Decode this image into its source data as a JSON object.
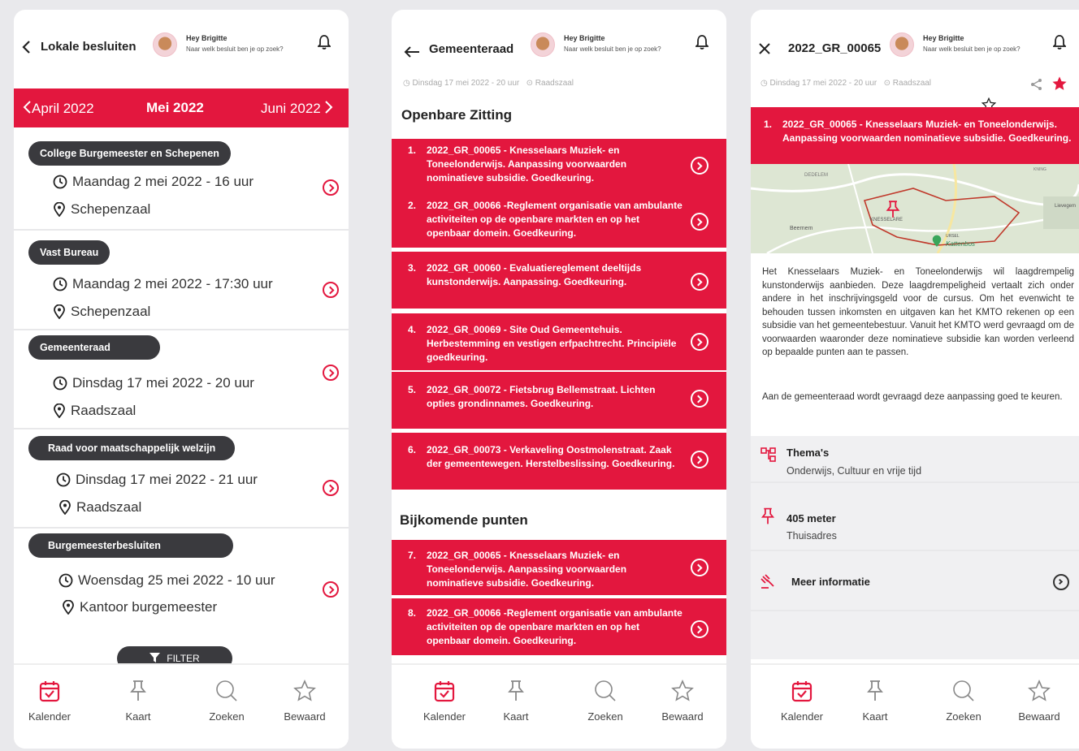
{
  "common": {
    "greeting": "Hey Brigitte",
    "greeting_sub": "Naar welk besluit ben je op zoek?",
    "nav": [
      "Kalender",
      "Kaart",
      "Zoeken",
      "Bewaard"
    ]
  },
  "screen1": {
    "title": "Lokale besluiten",
    "months": {
      "prev": "April 2022",
      "current": "Mei 2022",
      "next": "Juni 2022"
    },
    "events": [
      {
        "body": "College Burgemeester en Schepenen",
        "date": "Maandag 2 mei 2022 - 16 uur",
        "place": "Schepenzaal"
      },
      {
        "body": "Vast Bureau",
        "date": "Maandag 2 mei 2022 - 17:30 uur",
        "place": "Schepenzaal"
      },
      {
        "body": "Gemeenteraad",
        "date": "Dinsdag 17 mei 2022 - 20 uur",
        "place": "Raadszaal"
      },
      {
        "body": "Raad voor maatschappelijk welzijn",
        "date": "Dinsdag 17 mei 2022 - 21 uur",
        "place": "Raadszaal"
      },
      {
        "body": "Burgemeesterbesluiten",
        "date": "Woensdag 25 mei 2022 - 10  uur",
        "place": "Kantoor burgemeester"
      }
    ],
    "filter_label": "FILTER"
  },
  "screen2": {
    "title": "Gemeenteraad",
    "meta_date": "Dinsdag 17 mei 2022 - 20 uur",
    "meta_place": "Raadszaal",
    "section1": "Openbare Zitting",
    "section2": "Bijkomende punten",
    "items": [
      {
        "num": "1.",
        "text": "2022_GR_00065 - Knesselaars Muziek- en Toneelonderwijs. Aanpassing voorwaarden nominatieve subsidie. Goedkeuring."
      },
      {
        "num": "2.",
        "text": "2022_GR_00066 -Reglement organisatie van ambulante activiteiten op de openbare markten en op het openbaar domein. Goedkeuring."
      },
      {
        "num": "3.",
        "text": "2022_GR_00060 - Evaluatiereglement deeltijds kunstonderwijs. Aanpassing. Goedkeuring."
      },
      {
        "num": "4.",
        "text": "2022_GR_00069 - Site Oud Gemeentehuis. Herbestemming en vestigen erfpachtrecht. Principiële goedkeuring."
      },
      {
        "num": "5.",
        "text": "2022_GR_00072 - Fietsbrug Bellemstraat. Lichten opties grondinnames. Goedkeuring."
      },
      {
        "num": "6.",
        "text": "2022_GR_00073 - Verkaveling Oostmolenstraat. Zaak der gemeentewegen. Herstelbeslissing. Goedkeuring."
      }
    ],
    "extra_items": [
      {
        "num": "7.",
        "text": "2022_GR_00065 - Knesselaars Muziek- en Toneelonderwijs. Aanpassing voorwaarden nominatieve subsidie. Goedkeuring."
      },
      {
        "num": "8.",
        "text": "2022_GR_00066 -Reglement organisatie van ambulante activiteiten op de openbare markten en op het openbaar domein. Goedkeuring."
      }
    ]
  },
  "screen3": {
    "title": "2022_GR_00065",
    "meta_date": "Dinsdag 17 mei 2022 - 20 uur",
    "meta_place": "Raadszaal",
    "item_num": "1.",
    "item_text": "2022_GR_00065 - Knesselaars Muziek- en Toneelonderwijs. Aanpassing voorwaarden nominatieve subsidie. Goedkeuring.",
    "map_labels": [
      "DEDELEM",
      "Beernem",
      "KNESSELARE",
      "Kattenbos",
      "Lievegem",
      "URSEL",
      "KNING"
    ],
    "description": "Het Knesselaars Muziek- en Toneelonderwijs wil laagdrempelig kunstonderwijs aanbieden. Deze laagdrempeligheid vertaalt zich onder andere in het inschrijvingsgeld voor de cursus. Om het evenwicht te behouden tussen inkomsten en uitgaven kan het KMTO rekenen op een subsidie van het gemeentebestuur. Vanuit het KMTO werd gevraagd om de voorwaarden waaronder deze nominatieve subsidie kan worden verleend op bepaalde punten aan te passen.",
    "description2": "Aan de gemeenteraad wordt gevraagd deze aanpassing goed te keuren.",
    "themes_title": "Thema's",
    "themes_value": "Onderwijs, Cultuur en vrije tijd",
    "distance_title": "405 meter",
    "distance_value": "Thuisadres",
    "more_info": "Meer informatie"
  },
  "colors": {
    "accent": "#e3173e",
    "pill": "#3a3a3e"
  }
}
